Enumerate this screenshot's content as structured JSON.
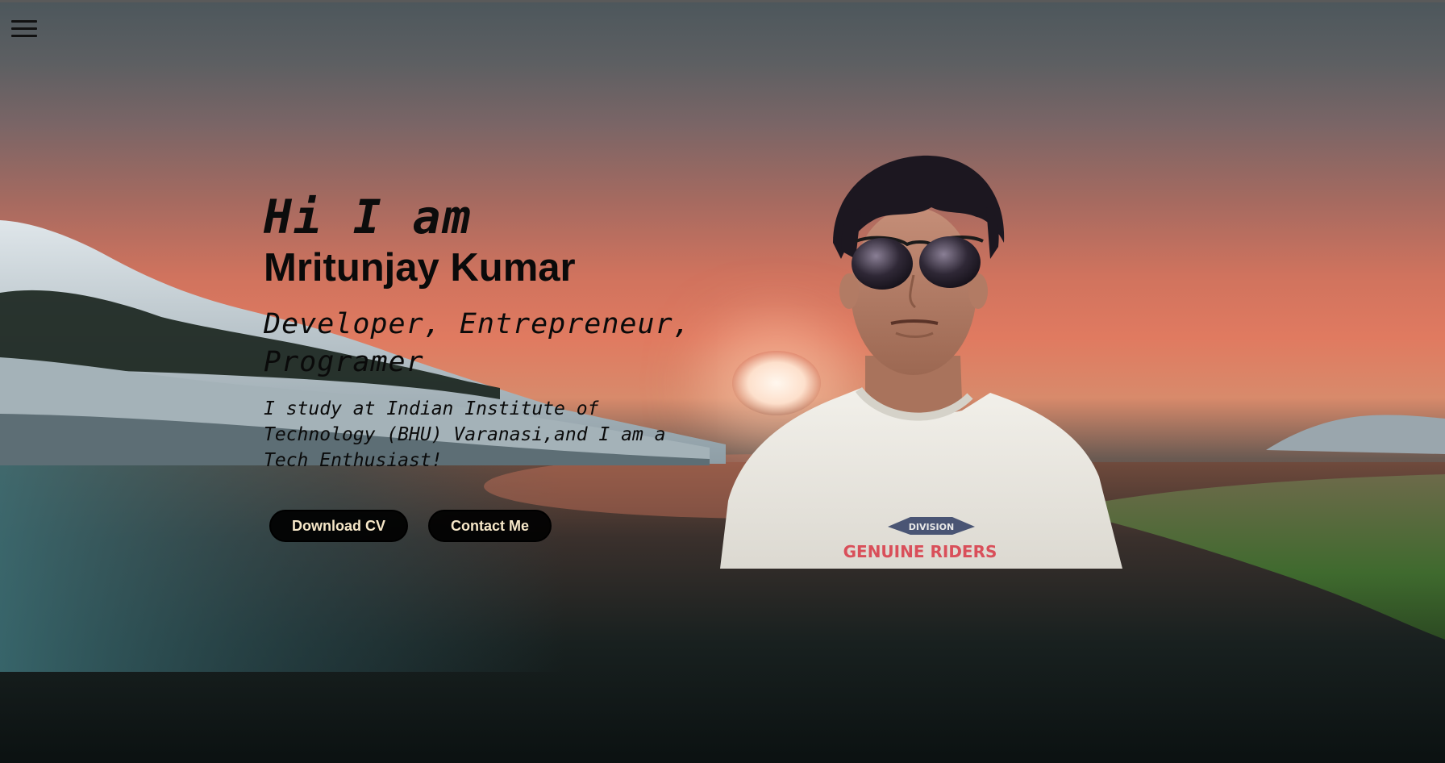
{
  "nav": {
    "menu_icon": "hamburger-menu-icon"
  },
  "hero": {
    "greeting": "Hi I am",
    "name": "Mritunjay Kumar",
    "roles": "Developer, Entrepreneur, Programer",
    "bio": "I study at Indian Institute of Technology (BHU) Varanasi,and I am a Tech Enthusiast!"
  },
  "actions": {
    "download_cv_label": "Download CV",
    "contact_label": "Contact Me"
  },
  "shirt_print": {
    "badge": "DIVISION",
    "text": "GENUINE RIDERS"
  },
  "colors": {
    "sky_top": "#4d575c",
    "sky_sunset": "#e07a60",
    "button_bg": "#000000",
    "button_text": "#f6e7c8"
  }
}
